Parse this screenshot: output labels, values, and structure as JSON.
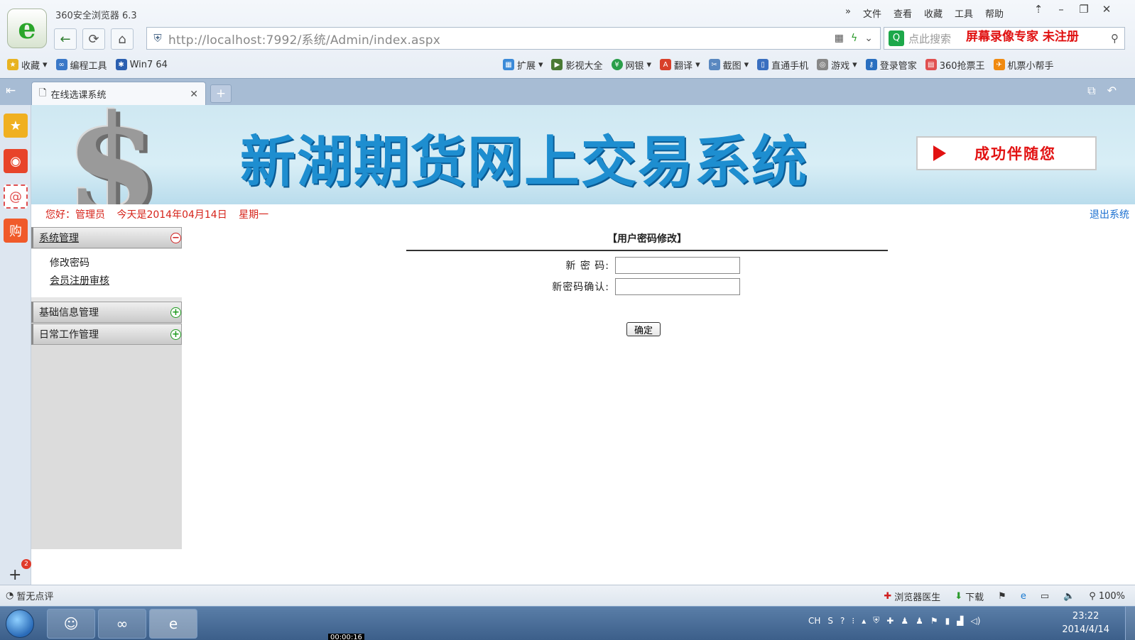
{
  "browser": {
    "title": "360安全浏览器 6.3",
    "menu": [
      "文件",
      "查看",
      "收藏",
      "工具",
      "帮助"
    ],
    "window_controls": [
      "shirt-icon",
      "minimize-icon",
      "restore-icon",
      "close-icon"
    ],
    "url": "http://localhost:7992/系统/Admin/index.aspx",
    "search_placeholder": "点此搜索",
    "recorder_label": "屏幕录像专家  未注册",
    "favorites": [
      {
        "label": "收藏",
        "icon": "star-icon"
      },
      {
        "label": "编程工具",
        "icon": "folder-icon"
      },
      {
        "label": "Win7 64",
        "icon": "paw-icon"
      }
    ],
    "extensions": [
      {
        "label": "扩展",
        "icon": "grid-icon"
      },
      {
        "label": "影视大全",
        "icon": "video-icon"
      },
      {
        "label": "网银",
        "icon": "bank-icon"
      },
      {
        "label": "翻译",
        "icon": "translate-icon"
      },
      {
        "label": "截图",
        "icon": "screenshot-icon"
      },
      {
        "label": "直通手机",
        "icon": "phone-icon"
      },
      {
        "label": "游戏",
        "icon": "gamepad-icon"
      },
      {
        "label": "登录管家",
        "icon": "key-icon"
      },
      {
        "label": "360抢票王",
        "icon": "ticket-icon"
      },
      {
        "label": "机票小帮手",
        "icon": "plane-icon"
      }
    ],
    "tab_title": "在线选课系统",
    "status_left": "暂无点评",
    "status_right": [
      "浏览器医生",
      "下载"
    ],
    "zoom": "100%"
  },
  "site": {
    "banner_title": "新湖期货网上交易系统",
    "banner_slogan": "成功伴随您",
    "greeting": "您好：管理员",
    "date_text": "今天是2014年04月14日",
    "weekday": "星期一",
    "logout": "退出系统"
  },
  "sidebar": {
    "groups": [
      {
        "label": "系统管理",
        "state": "expanded",
        "items": [
          "修改密码",
          "会员注册审核"
        ]
      },
      {
        "label": "基础信息管理",
        "state": "collapsed"
      },
      {
        "label": "日常工作管理",
        "state": "collapsed"
      }
    ]
  },
  "form": {
    "title": "【用户密码修改】",
    "fields": [
      {
        "label": "新 密 码:",
        "value": ""
      },
      {
        "label": "新密码确认:",
        "value": ""
      }
    ],
    "submit": "确定"
  },
  "taskbar": {
    "tray_lang": "CH",
    "time": "23:22",
    "date": "2014/4/14",
    "recording_time": "00:00:16"
  }
}
